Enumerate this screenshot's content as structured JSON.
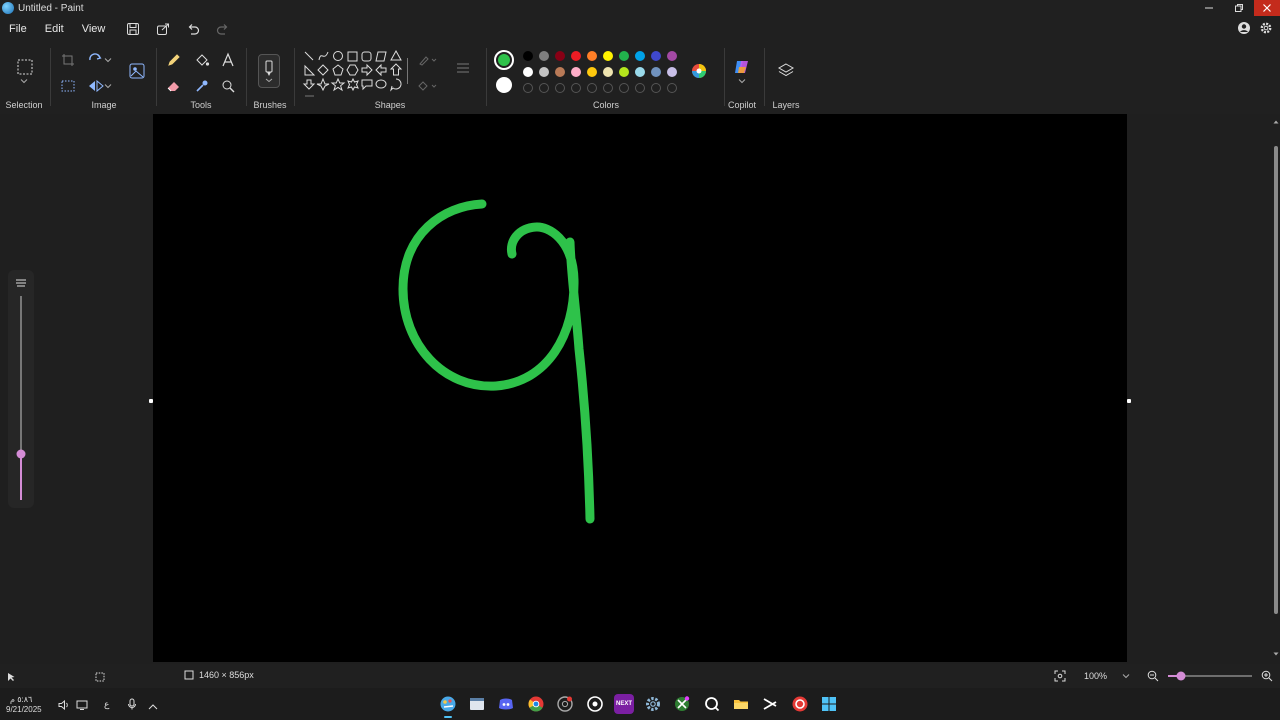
{
  "window": {
    "title": "Untitled - Paint"
  },
  "menu": {
    "file": "File",
    "edit": "Edit",
    "view": "View"
  },
  "ribbon": {
    "selection": "Selection",
    "image": "Image",
    "tools": "Tools",
    "brushes": "Brushes",
    "shapes": "Shapes",
    "colors": "Colors",
    "copilot": "Copilot",
    "layers": "Layers"
  },
  "colors": {
    "primary": "#2ec24a",
    "secondary": "#ffffff",
    "row1": [
      "#000000",
      "#7f7f7f",
      "#880015",
      "#ed1c24",
      "#ff7f27",
      "#fff200",
      "#22b14c",
      "#00a2e8",
      "#3f48cc",
      "#a349a4"
    ],
    "row2": [
      "#ffffff",
      "#c3c3c3",
      "#b97a57",
      "#ffaec9",
      "#ffc90e",
      "#efe4b0",
      "#b5e61d",
      "#99d9ea",
      "#7092be",
      "#c8bfe7"
    ]
  },
  "canvas": {
    "background": "#000000",
    "stroke_color": "#2ec24a"
  },
  "status": {
    "canvas_size": "1460 × 856px",
    "zoom": "100%"
  },
  "taskbar": {
    "time": "٥:٨٦ م",
    "date": "9/21/2025",
    "lang": "ع"
  }
}
